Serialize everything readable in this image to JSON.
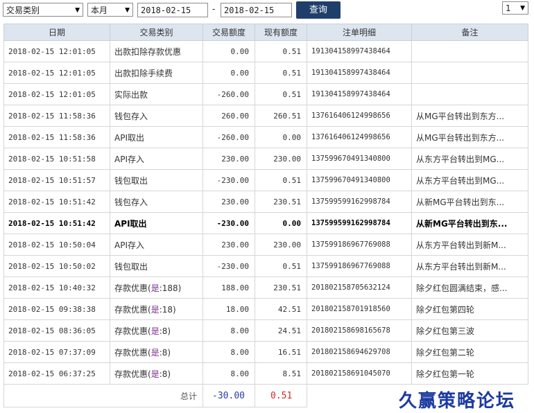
{
  "filters": {
    "type_select": "交易类别",
    "period_select": "本月",
    "date_from": "2018-02-15",
    "date_sep": "-",
    "date_to": "2018-02-15",
    "query_label": "查询",
    "page_select": "1"
  },
  "columns": [
    "日期",
    "交易类别",
    "交易额度",
    "现有额度",
    "注单明细",
    "备注"
  ],
  "rows": [
    {
      "date": "2018-02-15 12:01:05",
      "type": "出款扣除存款优惠",
      "hl": "",
      "suffix": "",
      "amount": "0.00",
      "balance": "0.51",
      "order": "191304158997438464",
      "note": ""
    },
    {
      "date": "2018-02-15 12:01:05",
      "type": "出款扣除手续费",
      "hl": "",
      "suffix": "",
      "amount": "0.00",
      "balance": "0.51",
      "order": "191304158997438464",
      "note": ""
    },
    {
      "date": "2018-02-15 12:01:05",
      "type": "实际出款",
      "hl": "",
      "suffix": "",
      "amount": "-260.00",
      "balance": "0.51",
      "order": "191304158997438464",
      "note": ""
    },
    {
      "date": "2018-02-15 11:58:36",
      "type": "钱包存入",
      "hl": "",
      "suffix": "",
      "amount": "260.00",
      "balance": "260.51",
      "order": "137616406124998656",
      "note": "从MG平台转出到东方..."
    },
    {
      "date": "2018-02-15 11:58:36",
      "type": "API取出",
      "hl": "",
      "suffix": "",
      "amount": "-260.00",
      "balance": "0.00",
      "order": "137616406124998656",
      "note": "从MG平台转出到东方..."
    },
    {
      "date": "2018-02-15 10:51:58",
      "type": "API存入",
      "hl": "",
      "suffix": "",
      "amount": "230.00",
      "balance": "230.00",
      "order": "137599670491340800",
      "note": "从东方平台转出到MG..."
    },
    {
      "date": "2018-02-15 10:51:57",
      "type": "钱包取出",
      "hl": "",
      "suffix": "",
      "amount": "-230.00",
      "balance": "0.51",
      "order": "137599670491340800",
      "note": "从东方平台转出到MG..."
    },
    {
      "date": "2018-02-15 10:51:42",
      "type": "钱包存入",
      "hl": "",
      "suffix": "",
      "amount": "230.00",
      "balance": "230.51",
      "order": "137599599162998784",
      "note": "从新MG平台转出到东..."
    },
    {
      "date": "2018-02-15 10:51:42",
      "type": "API取出",
      "hl": "",
      "suffix": "",
      "amount": "-230.00",
      "balance": "0.00",
      "order": "137599599162998784",
      "note": "从新MG平台转出到东...",
      "bold": true
    },
    {
      "date": "2018-02-15 10:50:04",
      "type": "API存入",
      "hl": "",
      "suffix": "",
      "amount": "230.00",
      "balance": "230.00",
      "order": "137599186967769088",
      "note": "从东方平台转出到新M..."
    },
    {
      "date": "2018-02-15 10:50:02",
      "type": "钱包取出",
      "hl": "",
      "suffix": "",
      "amount": "-230.00",
      "balance": "0.51",
      "order": "137599186967769088",
      "note": "从东方平台转出到新M..."
    },
    {
      "date": "2018-02-15 10:40:32",
      "type": "存款优惠(",
      "hl": "是",
      "suffix": ":188)",
      "amount": "188.00",
      "balance": "230.51",
      "order": "201802158705632124",
      "note": "除夕红包圆满结束，感..."
    },
    {
      "date": "2018-02-15 09:38:38",
      "type": "存款优惠(",
      "hl": "是",
      "suffix": ":18)",
      "amount": "18.00",
      "balance": "42.51",
      "order": "201802158701918560",
      "note": "除夕红包第四轮"
    },
    {
      "date": "2018-02-15 08:36:05",
      "type": "存款优惠(",
      "hl": "是",
      "suffix": ":8)",
      "amount": "8.00",
      "balance": "24.51",
      "order": "201802158698165678",
      "note": "除夕红包第三波"
    },
    {
      "date": "2018-02-15 07:37:09",
      "type": "存款优惠(",
      "hl": "是",
      "suffix": ":8)",
      "amount": "8.00",
      "balance": "16.51",
      "order": "201802158694629708",
      "note": "除夕红包第二轮"
    },
    {
      "date": "2018-02-15 06:37:25",
      "type": "存款优惠(",
      "hl": "是",
      "suffix": ":8)",
      "amount": "8.00",
      "balance": "8.51",
      "order": "201802158691045070",
      "note": "除夕红包第一轮"
    }
  ],
  "totals": {
    "label": "总计",
    "amount": "-30.00",
    "balance": "0.51"
  },
  "watermark": "久赢策略论坛",
  "colors": {
    "header_bg": "#dde5ef",
    "button_bg": "#1f3f6b",
    "total_negative": "#2a3ca8",
    "total_positive": "#d02a2a",
    "highlight": "#7a2c8c"
  }
}
